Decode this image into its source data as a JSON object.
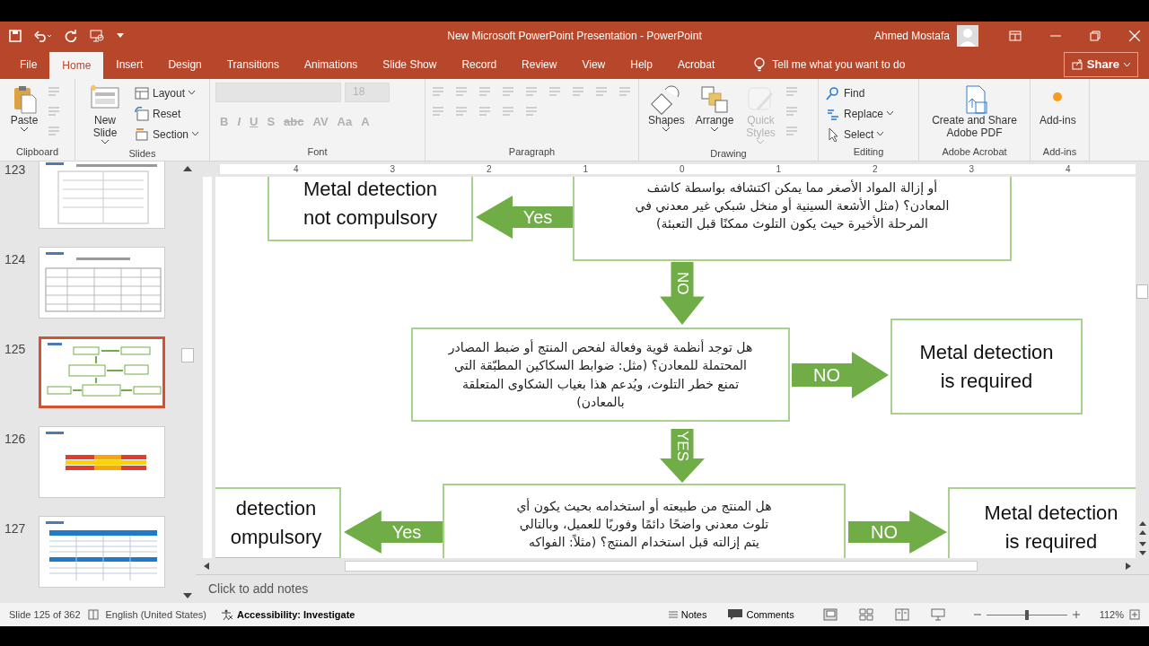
{
  "window": {
    "title": "New Microsoft PowerPoint Presentation  -  PowerPoint",
    "user": "Ahmed Mostafa"
  },
  "menu_tabs": [
    {
      "label": "File",
      "selected": false
    },
    {
      "label": "Home",
      "selected": true
    },
    {
      "label": "Insert",
      "selected": false
    },
    {
      "label": "Design",
      "selected": false
    },
    {
      "label": "Transitions",
      "selected": false
    },
    {
      "label": "Animations",
      "selected": false
    },
    {
      "label": "Slide Show",
      "selected": false
    },
    {
      "label": "Record",
      "selected": false
    },
    {
      "label": "Review",
      "selected": false
    },
    {
      "label": "View",
      "selected": false
    },
    {
      "label": "Help",
      "selected": false
    },
    {
      "label": "Acrobat",
      "selected": false
    }
  ],
  "tell_me": {
    "placeholder": "Tell me what you want to do"
  },
  "share_button": "Share",
  "ribbon_groups": [
    {
      "label": "Clipboard",
      "items": [
        {
          "kind": "large",
          "label": "Paste",
          "caret": true,
          "disabled": false
        },
        {
          "kind": "icons",
          "disabled": true
        }
      ]
    },
    {
      "label": "Slides",
      "items": [
        {
          "kind": "large",
          "label": "New Slide",
          "caret": true,
          "disabled": false
        },
        {
          "kind": "small",
          "label": "Layout",
          "caret": true,
          "disabled": false
        },
        {
          "kind": "small",
          "label": "Reset",
          "caret": false,
          "disabled": false
        },
        {
          "kind": "small",
          "label": "Section",
          "caret": true,
          "disabled": false
        }
      ]
    },
    {
      "label": "Font",
      "items": [
        {
          "kind": "font",
          "size": "18",
          "disabled": true,
          "glyphs": [
            "B",
            "I",
            "U",
            "S",
            "abc",
            "AV",
            "Aa",
            "A"
          ]
        }
      ]
    },
    {
      "label": "Paragraph",
      "items": [
        {
          "kind": "icons",
          "disabled": true
        }
      ]
    },
    {
      "label": "Drawing",
      "items": [
        {
          "kind": "large",
          "label": "Shapes",
          "caret": true,
          "disabled": false
        },
        {
          "kind": "large",
          "label": "Arrange",
          "caret": true,
          "disabled": false
        },
        {
          "kind": "large",
          "label": "Quick Styles",
          "caret": true,
          "disabled": true
        },
        {
          "kind": "icons",
          "disabled": true
        }
      ]
    },
    {
      "label": "Editing",
      "items": [
        {
          "kind": "small",
          "label": "Find",
          "caret": false,
          "disabled": false
        },
        {
          "kind": "small",
          "label": "Replace",
          "caret": true,
          "disabled": false
        },
        {
          "kind": "small",
          "label": "Select",
          "caret": true,
          "disabled": false
        }
      ]
    },
    {
      "label": "Adobe Acrobat",
      "items": [
        {
          "kind": "large",
          "label": "Create and Share Adobe PDF",
          "caret": false,
          "disabled": false
        }
      ]
    },
    {
      "label": "Add-ins",
      "items": [
        {
          "kind": "large",
          "label": "Add-ins",
          "caret": false,
          "disabled": false
        }
      ]
    }
  ],
  "ruler": [
    "4",
    "3",
    "2",
    "1",
    "0",
    "1",
    "2",
    "3",
    "4"
  ],
  "slides": [
    {
      "number": "123",
      "kind": "text",
      "selected": false
    },
    {
      "number": "124",
      "kind": "table",
      "selected": false
    },
    {
      "number": "125",
      "kind": "flowchart",
      "selected": true
    },
    {
      "number": "126",
      "kind": "bars",
      "selected": false
    },
    {
      "number": "127",
      "kind": "bluetable",
      "selected": false
    }
  ],
  "flowchart": [
    {
      "kind": "box",
      "lines": [
        "Metal detection",
        "not compulsory"
      ]
    },
    {
      "kind": "leftarrow",
      "label": "Yes"
    },
    {
      "kind": "rtlbox",
      "lines": [
        "أو إزالة المواد الأصغر مما يمكن اكتشافه بواسطة كاشف",
        "المعادن؟ (مثل الأشعة السينية أو منخل شبكي غير معدني في",
        "المرحلة الأخيرة حيث يكون التلوث ممكنًا قبل التعبئة)"
      ]
    },
    {
      "kind": "downarrow",
      "label": "NO"
    },
    {
      "kind": "rtlbox",
      "lines": [
        "هل توجد أنظمة قوية وفعالة لفحص المنتج أو ضبط المصادر",
        "المحتملة للمعادن؟ (مثل: ضوابط السكاكين المطبّقة التي",
        "تمنع خطر التلوث، ويُدعم هذا بغياب الشكاوى المتعلقة",
        "بالمعادن)"
      ]
    },
    {
      "kind": "rightarrow",
      "label": "NO"
    },
    {
      "kind": "box",
      "lines": [
        "Metal detection",
        "is required"
      ]
    },
    {
      "kind": "downarrow",
      "label": "YES"
    },
    {
      "kind": "box",
      "lines": [
        "detection",
        "ompulsory"
      ]
    },
    {
      "kind": "leftarrow",
      "label": "Yes"
    },
    {
      "kind": "rtlbox",
      "lines": [
        "هل المنتج من طبيعته أو استخدامه بحيث يكون أي",
        "تلوث معدني واضحًا دائمًا وفوريًا للعميل، وبالتالي",
        "يتم إزالته قبل استخدام المنتج؟ (مثلاً: الفواكه"
      ]
    },
    {
      "kind": "rightarrow",
      "label": "NO"
    },
    {
      "kind": "box",
      "lines": [
        "Metal detection",
        "is required"
      ]
    }
  ],
  "notes": {
    "placeholder": "Click to add notes"
  },
  "status_bar": {
    "slide": "Slide 125 of 362",
    "language": "English (United States)",
    "accessibility": "Accessibility: Investigate",
    "notes": "Notes",
    "comments": "Comments",
    "zoom": "112%",
    "zoom_slider": {
      "level": 0.5
    }
  }
}
